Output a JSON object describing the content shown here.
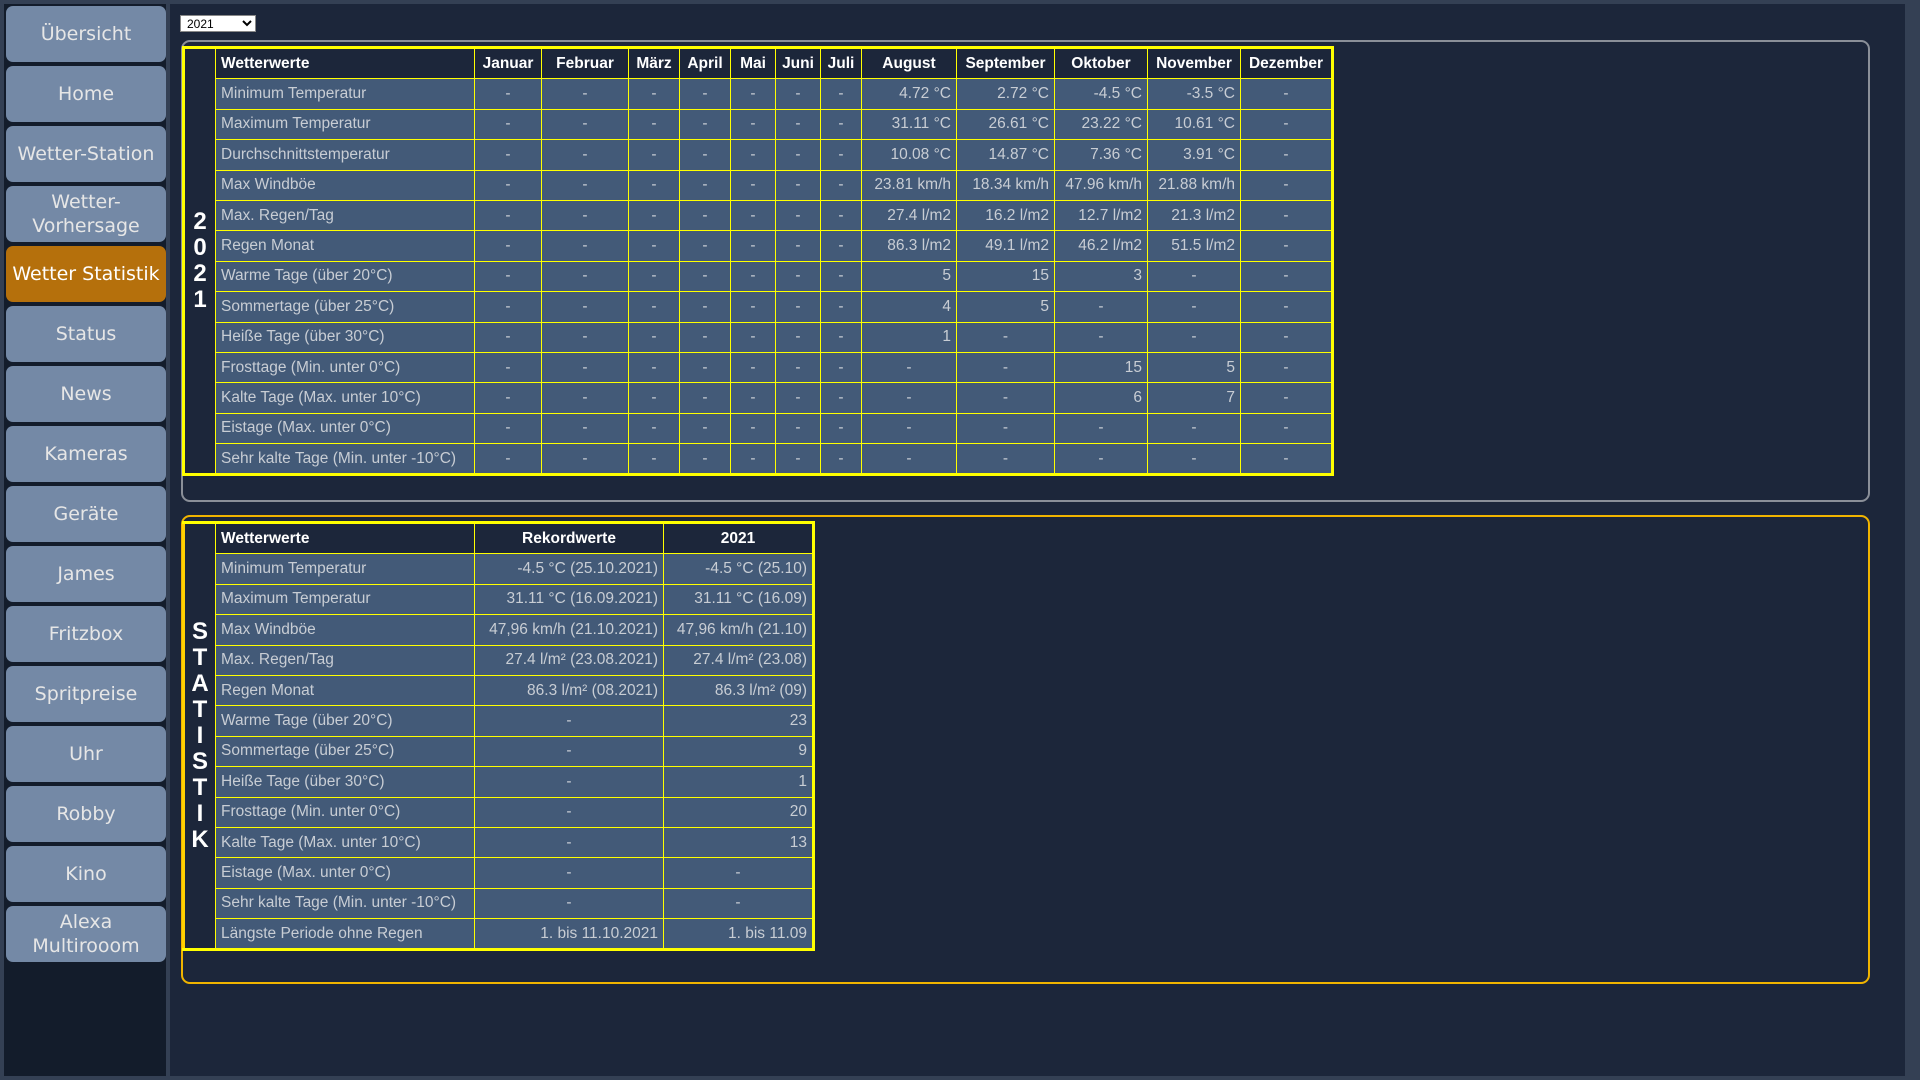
{
  "sidebar": {
    "items": [
      {
        "label": "Übersicht",
        "active": false
      },
      {
        "label": "Home",
        "active": false
      },
      {
        "label": "Wetter-Station",
        "active": false
      },
      {
        "label": "Wetter-\nVorhersage",
        "active": false
      },
      {
        "label": "Wetter Statistik",
        "active": true
      },
      {
        "label": "Status",
        "active": false
      },
      {
        "label": "News",
        "active": false
      },
      {
        "label": "Kameras",
        "active": false
      },
      {
        "label": "Geräte",
        "active": false
      },
      {
        "label": "James",
        "active": false
      },
      {
        "label": "Fritzbox",
        "active": false
      },
      {
        "label": "Spritpreise",
        "active": false
      },
      {
        "label": "Uhr",
        "active": false
      },
      {
        "label": "Robby",
        "active": false
      },
      {
        "label": "Kino",
        "active": false
      },
      {
        "label": "Alexa\nMultirooom",
        "active": false
      }
    ]
  },
  "year_select": {
    "value": "2021"
  },
  "monthly": {
    "side_label": "2021",
    "header": [
      "Wetterwerte",
      "Januar",
      "Februar",
      "März",
      "April",
      "Mai",
      "Juni",
      "Juli",
      "August",
      "September",
      "Oktober",
      "November",
      "Dezember"
    ],
    "rows": [
      [
        "Minimum Temperatur",
        "-",
        "-",
        "-",
        "-",
        "-",
        "-",
        "-",
        "4.72 °C",
        "2.72 °C",
        "-4.5 °C",
        "-3.5 °C",
        "-"
      ],
      [
        "Maximum Temperatur",
        "-",
        "-",
        "-",
        "-",
        "-",
        "-",
        "-",
        "31.11 °C",
        "26.61 °C",
        "23.22 °C",
        "10.61 °C",
        "-"
      ],
      [
        "Durchschnittstemperatur",
        "-",
        "-",
        "-",
        "-",
        "-",
        "-",
        "-",
        "10.08 °C",
        "14.87 °C",
        "7.36 °C",
        "3.91 °C",
        "-"
      ],
      [
        "Max Windböe",
        "-",
        "-",
        "-",
        "-",
        "-",
        "-",
        "-",
        "23.81 km/h",
        "18.34 km/h",
        "47.96 km/h",
        "21.88 km/h",
        "-"
      ],
      [
        "Max. Regen/Tag",
        "-",
        "-",
        "-",
        "-",
        "-",
        "-",
        "-",
        "27.4 l/m2",
        "16.2 l/m2",
        "12.7 l/m2",
        "21.3 l/m2",
        "-"
      ],
      [
        "Regen Monat",
        "-",
        "-",
        "-",
        "-",
        "-",
        "-",
        "-",
        "86.3 l/m2",
        "49.1 l/m2",
        "46.2 l/m2",
        "51.5 l/m2",
        "-"
      ],
      [
        "Warme Tage (über 20°C)",
        "-",
        "-",
        "-",
        "-",
        "-",
        "-",
        "-",
        "5",
        "15",
        "3",
        "-",
        "-"
      ],
      [
        "Sommertage (über 25°C)",
        "-",
        "-",
        "-",
        "-",
        "-",
        "-",
        "-",
        "4",
        "5",
        "-",
        "-",
        "-"
      ],
      [
        "Heiße Tage (über 30°C)",
        "-",
        "-",
        "-",
        "-",
        "-",
        "-",
        "-",
        "1",
        "-",
        "-",
        "-",
        "-"
      ],
      [
        "Frosttage (Min. unter 0°C)",
        "-",
        "-",
        "-",
        "-",
        "-",
        "-",
        "-",
        "-",
        "-",
        "15",
        "5",
        "-"
      ],
      [
        "Kalte Tage (Max. unter 10°C)",
        "-",
        "-",
        "-",
        "-",
        "-",
        "-",
        "-",
        "-",
        "-",
        "6",
        "7",
        "-"
      ],
      [
        "Eistage (Max. unter 0°C)",
        "-",
        "-",
        "-",
        "-",
        "-",
        "-",
        "-",
        "-",
        "-",
        "-",
        "-",
        "-"
      ],
      [
        "Sehr kalte Tage (Min. unter -10°C)",
        "-",
        "-",
        "-",
        "-",
        "-",
        "-",
        "-",
        "-",
        "-",
        "-",
        "-",
        "-"
      ]
    ]
  },
  "stats": {
    "side_label": "STATISTIK",
    "header": [
      "Wetterwerte",
      "Rekordwerte",
      "2021"
    ],
    "rows": [
      [
        "Minimum Temperatur",
        "-4.5 °C (25.10.2021)",
        "-4.5 °C (25.10)"
      ],
      [
        "Maximum Temperatur",
        "31.11 °C (16.09.2021)",
        "31.11 °C (16.09)"
      ],
      [
        "Max Windböe",
        "47,96 km/h (21.10.2021)",
        "47,96 km/h (21.10)"
      ],
      [
        "Max. Regen/Tag",
        "27.4 l/m² (23.08.2021)",
        "27.4 l/m² (23.08)"
      ],
      [
        "Regen Monat",
        "86.3 l/m² (08.2021)",
        "86.3 l/m² (09)"
      ],
      [
        "Warme Tage (über 20°C)",
        "-",
        "23"
      ],
      [
        "Sommertage (über 25°C)",
        "-",
        "9"
      ],
      [
        "Heiße Tage (über 30°C)",
        "-",
        "1"
      ],
      [
        "Frosttage (Min. unter 0°C)",
        "-",
        "20"
      ],
      [
        "Kalte Tage (Max. unter 10°C)",
        "-",
        "13"
      ],
      [
        "Eistage (Max. unter 0°C)",
        "-",
        "-"
      ],
      [
        "Sehr kalte Tage (Min. unter -10°C)",
        "-",
        "-"
      ],
      [
        "Längste Periode ohne Regen",
        "1. bis 11.10.2021",
        "1. bis 11.09"
      ]
    ]
  }
}
